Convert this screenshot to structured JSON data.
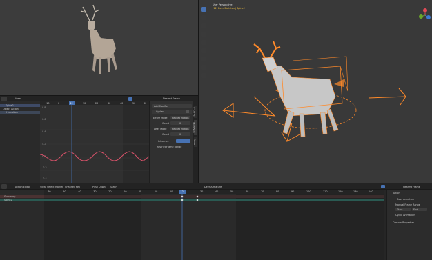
{
  "viewport": {
    "mode_label": "User Perspective",
    "collection_label": "(12) Deer Skeleton | Spine2"
  },
  "graph_editor": {
    "view_label": "View",
    "channel_groups": [
      "Spine2",
      "Object Action",
      "X Location"
    ],
    "active_frame": "12",
    "frame_ruler": [
      "-10",
      "0",
      "10",
      "20",
      "30",
      "40",
      "50",
      "60",
      "70"
    ],
    "value_ruler": [
      "0.8",
      "0.6",
      "0.4",
      "0.2",
      "0.0",
      "-0.2",
      "-0.4"
    ],
    "sidebar": {
      "tab_label": "Modifiers",
      "add_modifier": "Add Modifier",
      "modifier_name": "Cycles",
      "before_mode_label": "Before Mode",
      "before_mode_value": "Repeat Motion",
      "before_count_label": "Count",
      "before_count_value": "0",
      "after_mode_label": "After Mode",
      "after_mode_value": "Repeat Motion",
      "after_count_label": "Count",
      "after_count_value": "0",
      "influence_label": "Influence",
      "restrict_label": "Restrict Frame Range",
      "side_tabs": [
        "F-Curve",
        "Modifiers",
        "View"
      ]
    },
    "right_header_label": "Nearest Frame"
  },
  "dopesheet": {
    "mode_label": "Action Editor",
    "menus": [
      "View",
      "Select",
      "Marker",
      "Channel",
      "Key"
    ],
    "action_name": "Deer Armature",
    "summary_label": "Summary",
    "track_label": "Spine2",
    "push_down": "Push Down",
    "stash": "Stash",
    "playhead_frame": "12",
    "frame_ruler": [
      "-60",
      "-50",
      "-40",
      "-30",
      "-20",
      "-10",
      "0",
      "10",
      "20",
      "30",
      "40",
      "50",
      "60",
      "70",
      "80",
      "90",
      "100",
      "110",
      "120",
      "130",
      "140"
    ],
    "playhead_overlay": "Layer",
    "nearest_frame": "Nearest Frame",
    "side_panel": {
      "action_header": "Action",
      "action_name": "Deer Armature",
      "manual_frame_range": "Manual Frame Range",
      "start_label": "Start",
      "end_label": "End",
      "cyclic_label": "Cyclic Animation",
      "custom_props": "Custom Properties"
    }
  },
  "colors": {
    "accent_blue": "#4772b3",
    "curve_red": "#d9526a",
    "selection_orange": "#ff8a2a",
    "teal_track": "#2a5a52"
  }
}
